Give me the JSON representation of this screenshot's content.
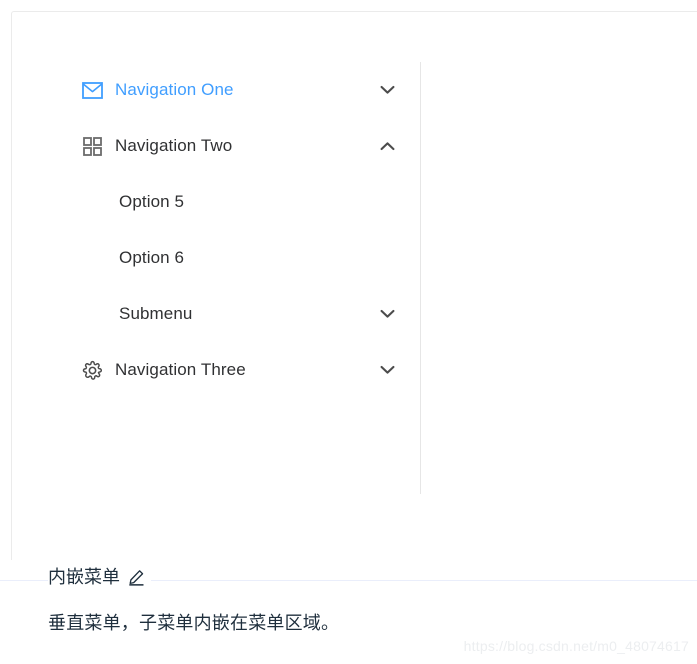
{
  "colors": {
    "active_blue": "#409eff",
    "text_default": "#303133",
    "border": "#ebebeb",
    "menu_divider": "#e6e6e6",
    "rule": "#eaeefb",
    "watermark": "#eceef0"
  },
  "menu": {
    "items": [
      {
        "label": "Navigation One",
        "icon": "mail-icon",
        "chevron": "chevron-down-icon",
        "active": true,
        "level": "top"
      },
      {
        "label": "Navigation Two",
        "icon": "grid-icon",
        "chevron": "chevron-up-icon",
        "active": false,
        "level": "top"
      },
      {
        "label": "Option 5",
        "icon": "",
        "chevron": "",
        "active": false,
        "level": "sub"
      },
      {
        "label": "Option 6",
        "icon": "",
        "chevron": "",
        "active": false,
        "level": "sub"
      },
      {
        "label": "Submenu",
        "icon": "",
        "chevron": "chevron-down-icon",
        "active": false,
        "level": "sub"
      },
      {
        "label": "Navigation Three",
        "icon": "gear-icon",
        "chevron": "chevron-down-icon",
        "active": false,
        "level": "top"
      }
    ]
  },
  "description": {
    "title": "内嵌菜单",
    "edit_icon": "pencil-icon",
    "body": "垂直菜单，子菜单内嵌在菜单区域。"
  },
  "watermark": {
    "text": "https://blog.csdn.net/m0_48074617"
  }
}
